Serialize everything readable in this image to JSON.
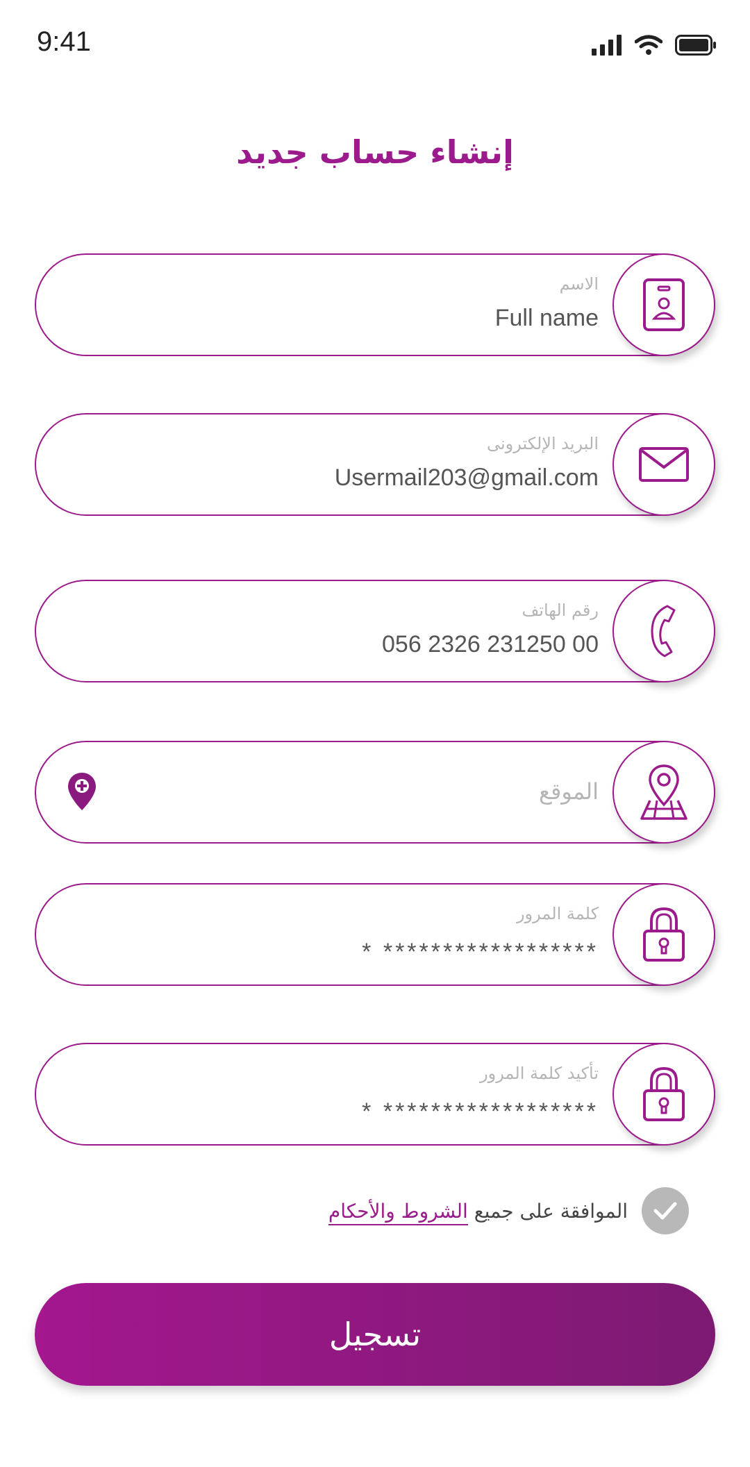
{
  "status": {
    "time": "9:41"
  },
  "title": "إنشاء حساب جديد",
  "fields": [
    {
      "label": "الاسم",
      "value": "Full name",
      "icon": "id-card-icon"
    },
    {
      "label": "البريد الإلكترونى",
      "value": "Usermail203@gmail.com",
      "icon": "envelope-icon"
    },
    {
      "label": "رقم الهاتف",
      "value": "056 2326 231250 00",
      "icon": "phone-icon"
    },
    {
      "placeholder": "الموقع",
      "icon": "map-pin-icon"
    },
    {
      "label": "كلمة المرور",
      "value": "* ******************",
      "icon": "lock-icon"
    },
    {
      "label": "تأكيد كلمة المرور",
      "value": "* ******************",
      "icon": "lock-icon"
    }
  ],
  "terms": {
    "prefix": "الموافقة على جميع",
    "link": "الشروط والأحكام",
    "checked": true
  },
  "submit": {
    "label": "تسجيل"
  },
  "colors": {
    "accent": "#9c1b8c",
    "gradient_end": "#7c1a72",
    "muted": "#b5b5b5"
  }
}
